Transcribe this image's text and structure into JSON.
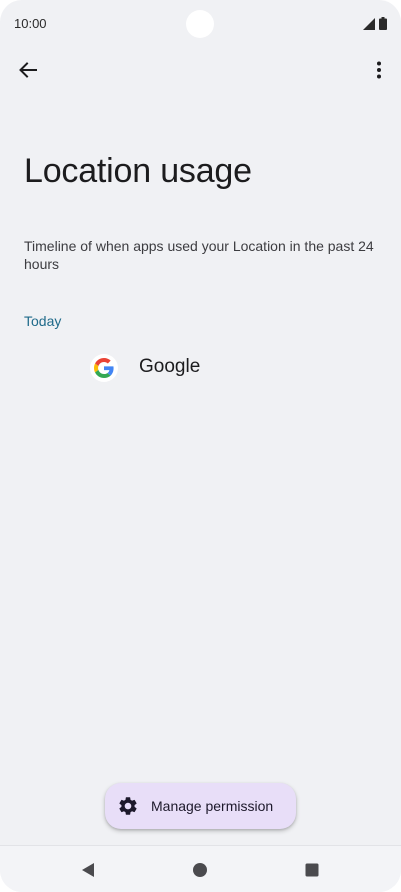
{
  "status_bar": {
    "time": "10:00",
    "icons": [
      "signal-icon",
      "battery-icon"
    ]
  },
  "app_bar": {
    "back_icon": "arrow-left-icon",
    "more_icon": "more-vert-icon"
  },
  "page": {
    "title": "Location usage",
    "description": "Timeline of when apps used your Location in the past 24 hours"
  },
  "timeline": {
    "section_label": "Today",
    "apps": [
      {
        "name": "Google",
        "icon": "google-icon"
      }
    ]
  },
  "fab": {
    "label": "Manage permission",
    "icon": "gear-icon",
    "color": "#e8def8"
  },
  "nav_bar": {
    "buttons": [
      "back-triangle-icon",
      "home-circle-icon",
      "recents-square-icon"
    ]
  },
  "colors": {
    "background": "#f0f1f4",
    "accent": "#1f6a8a",
    "text_primary": "#1c1c1e"
  }
}
